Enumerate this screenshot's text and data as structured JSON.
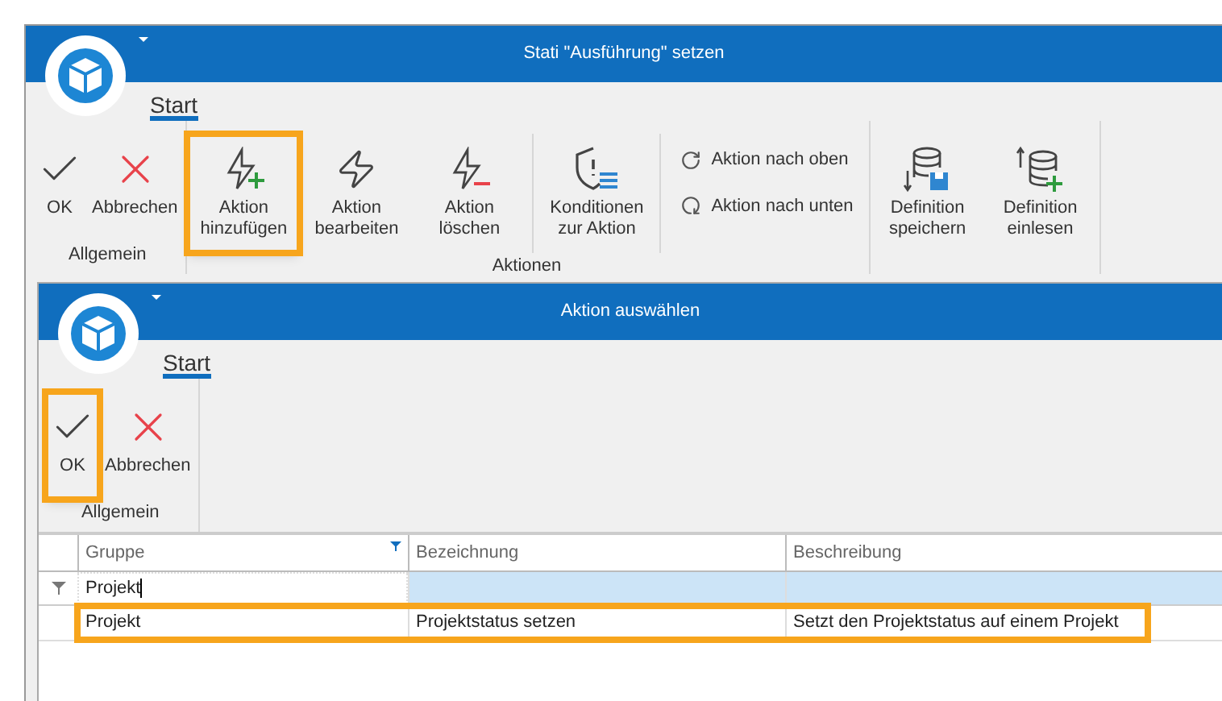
{
  "window": {
    "title": "Stati \"Ausführung\" setzen"
  },
  "tabs": [
    {
      "label": "Start",
      "selected": true
    }
  ],
  "ribbon_groups": [
    {
      "label": "Allgemein",
      "sections": [
        {
          "kind": "row",
          "buttons": [
            {
              "kind": "check",
              "label": "OK",
              "highlighted": false
            },
            {
              "kind": "cross",
              "label": "Abbrechen",
              "highlighted": false
            }
          ]
        }
      ]
    },
    {
      "label": "Aktionen",
      "sections": [
        {
          "kind": "row",
          "buttons": [
            {
              "kind": "bolt-plus",
              "label": "Aktion hinzufügen",
              "highlighted": true
            },
            {
              "kind": "bolt",
              "label": "Aktion bearbeiten",
              "highlighted": false
            },
            {
              "kind": "bolt-minus",
              "label": "Aktion löschen",
              "highlighted": false
            }
          ]
        },
        {
          "kind": "row",
          "buttons": [
            {
              "kind": "shield",
              "label": "Konditionen zur Aktion",
              "highlighted": false
            }
          ]
        },
        {
          "kind": "column",
          "buttons": [
            {
              "kind": "up",
              "label": "Aktion nach oben",
              "highlighted": false
            },
            {
              "kind": "down",
              "label": "Aktion nach unten",
              "highlighted": false
            }
          ]
        }
      ]
    },
    {
      "sections": [
        {
          "kind": "row",
          "buttons": [
            {
              "kind": "db-save",
              "label": "Definition speichern",
              "highlighted": false
            },
            {
              "kind": "db-add",
              "label": "Definition einlesen",
              "highlighted": false
            }
          ]
        }
      ]
    }
  ],
  "dialog": {
    "title": "Aktion auswählen",
    "tabs": [
      {
        "label": "Start",
        "selected": true
      }
    ],
    "ribbon_groups": [
      {
        "label": "Allgemein",
        "sections": [
          {
            "kind": "row",
            "buttons": [
              {
                "kind": "check",
                "label": "OK",
                "highlighted": true
              },
              {
                "kind": "cross",
                "label": "Abbrechen",
                "highlighted": false
              }
            ]
          }
        ]
      }
    ],
    "table": {
      "columns": [
        {
          "label": "Gruppe",
          "filtered": true
        },
        {
          "label": "Bezeichnung",
          "filtered": false
        },
        {
          "label": "Beschreibung",
          "filtered": false
        }
      ],
      "filter_row": [
        "Projekt"
      ],
      "rows": [
        {
          "cells": [
            "Projekt",
            "Projektstatus setzen",
            "Setzt den Projektstatus auf einem Projekt"
          ],
          "highlighted": true
        }
      ]
    }
  }
}
